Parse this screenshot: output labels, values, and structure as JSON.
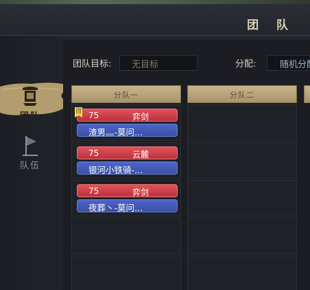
{
  "window": {
    "title": "团 队"
  },
  "sidebar": {
    "items": [
      {
        "label": "团队",
        "icon": "team-banner-icon",
        "active": true
      },
      {
        "label": "队伍",
        "icon": "party-flag-icon",
        "active": false
      }
    ]
  },
  "settings": {
    "goal_label": "团队目标:",
    "goal_value": "无目标",
    "alloc_label": "分配:",
    "alloc_value": "随机分配"
  },
  "groups": [
    {
      "title": "分队一",
      "members": [
        {
          "level": "75",
          "class": "弈剑",
          "name": "渣男灬-莫问…",
          "leader_badge": "团"
        },
        {
          "level": "75",
          "class": "云麓",
          "name": "银河小铁骑-…"
        },
        {
          "level": "75",
          "class": "弈剑",
          "name": "夜葬丶-莫问…"
        }
      ]
    },
    {
      "title": "分队二",
      "members": []
    }
  ],
  "colors": {
    "member_level_bar": "#c9323c",
    "member_name_bar": "#4258b5",
    "group_header": "#b9a47a",
    "leader_badge": "#f2d84a"
  }
}
